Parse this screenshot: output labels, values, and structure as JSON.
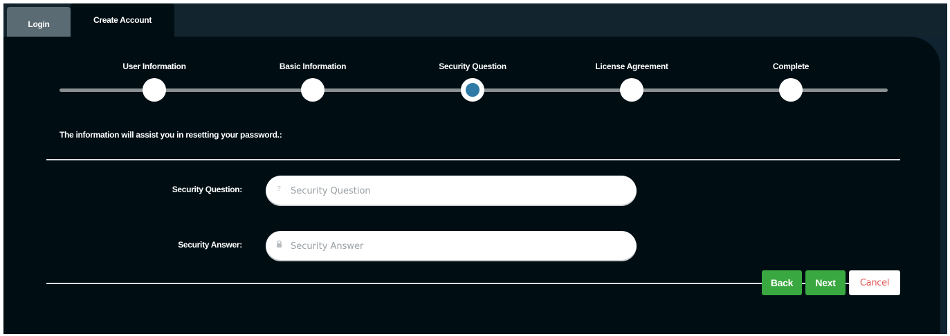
{
  "tabs": {
    "login": "Login",
    "create_account": "Create Account"
  },
  "wizard": {
    "steps": [
      {
        "label": "User Information",
        "state": "done"
      },
      {
        "label": "Basic Information",
        "state": "done"
      },
      {
        "label": "Security Question",
        "state": "current"
      },
      {
        "label": "License Agreement",
        "state": "pending"
      },
      {
        "label": "Complete",
        "state": "pending"
      }
    ],
    "current_step": 3
  },
  "form": {
    "intro": "The information will assist you in resetting your password.:",
    "security_question": {
      "label": "Security Question:",
      "placeholder": "Security Question",
      "value": "",
      "icon": "question-mark-icon"
    },
    "security_answer": {
      "label": "Security Answer:",
      "placeholder": "Security Answer",
      "value": "",
      "icon": "lock-icon"
    }
  },
  "buttons": {
    "back": "Back",
    "next": "Next",
    "cancel": "Cancel"
  },
  "colors": {
    "background": "#000e14",
    "accent_green": "#3aa840",
    "current_step": "#2f7ba6",
    "cancel_text": "#e05550"
  }
}
